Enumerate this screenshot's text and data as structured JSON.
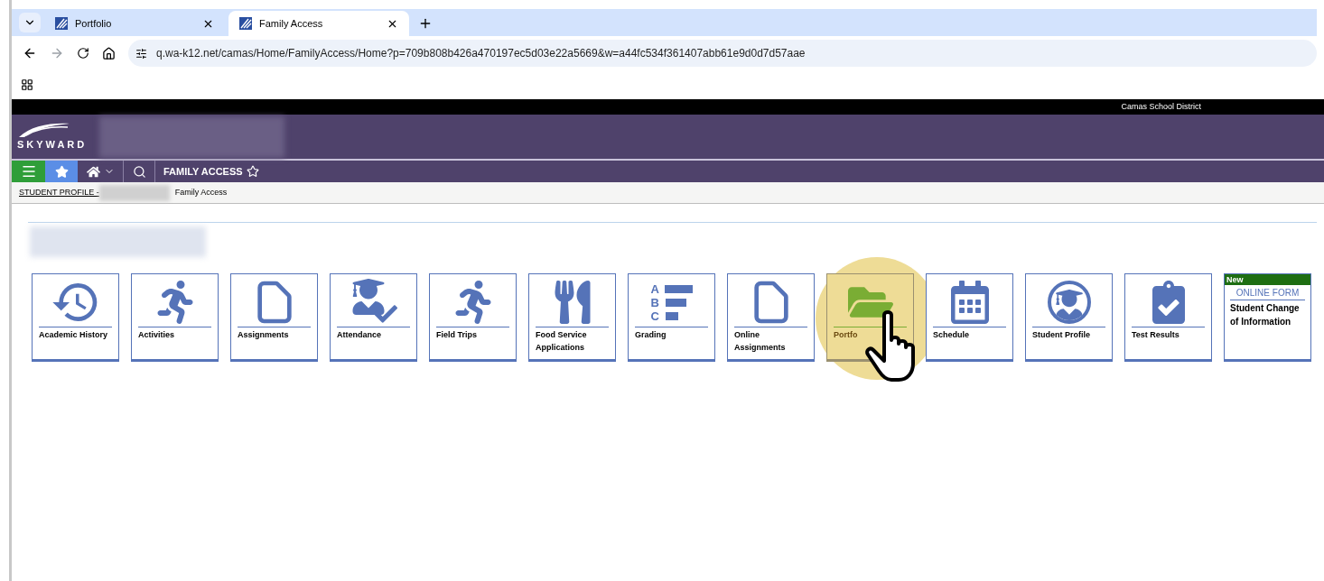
{
  "browser": {
    "tabs": [
      {
        "title": "Portfolio",
        "selected": false
      },
      {
        "title": "Family Access",
        "selected": true
      }
    ],
    "url": "q.wa-k12.net/camas/Home/FamilyAccess/Home?p=709b808b426a470197ec5d03e22a5669&w=a44fc534f361407abb61e9d0d7d57aae"
  },
  "header": {
    "district": "Camas School District",
    "logo": "SKYWARD",
    "page_title": "FAMILY ACCESS"
  },
  "breadcrumb": [
    "STUDENT PROFILE -",
    "Family Access"
  ],
  "tiles": [
    {
      "kind": "history",
      "label": "Academic History",
      "hovered": false
    },
    {
      "kind": "run",
      "label": "Activities",
      "hovered": false
    },
    {
      "kind": "document",
      "label": "Assignments",
      "hovered": false
    },
    {
      "kind": "attendance",
      "label": "Attendance",
      "hovered": false
    },
    {
      "kind": "run",
      "label": "Field Trips",
      "hovered": false
    },
    {
      "kind": "food",
      "label": "Food Service Applications",
      "hovered": false
    },
    {
      "kind": "grading",
      "label": "Grading",
      "hovered": false,
      "letters": [
        "A",
        "B",
        "C"
      ]
    },
    {
      "kind": "document",
      "label": "Online Assignments",
      "hovered": false
    },
    {
      "kind": "folder",
      "label": "Portfo",
      "hovered": true
    },
    {
      "kind": "calendar",
      "label": "Schedule",
      "hovered": false
    },
    {
      "kind": "profile",
      "label": "Student Profile",
      "hovered": false
    },
    {
      "kind": "clipboard",
      "label": "Test Results",
      "hovered": false
    },
    {
      "kind": "form",
      "badge": "New",
      "heading": "ONLINE FORM",
      "label": "Student Change of Information",
      "hovered": false
    }
  ]
}
